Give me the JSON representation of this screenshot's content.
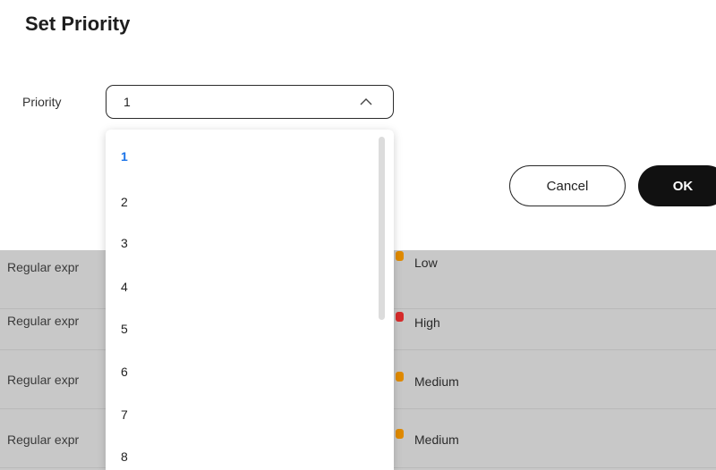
{
  "dialog": {
    "title": "Set Priority",
    "field_label": "Priority",
    "select_value": "1",
    "cancel_label": "Cancel",
    "ok_label": "OK"
  },
  "dropdown": {
    "options": [
      "1",
      "2",
      "3",
      "4",
      "5",
      "6",
      "7",
      "8"
    ],
    "selected": "1"
  },
  "table": {
    "rows": [
      {
        "name": "Regular expr",
        "level": "Low",
        "color": "#e08a00"
      },
      {
        "name": "Regular expr",
        "level": "High",
        "color": "#d62b2b"
      },
      {
        "name": "Regular expr",
        "level": "Medium",
        "color": "#e08a00"
      },
      {
        "name": "Regular expr",
        "level": "Medium",
        "color": "#e08a00"
      }
    ]
  }
}
